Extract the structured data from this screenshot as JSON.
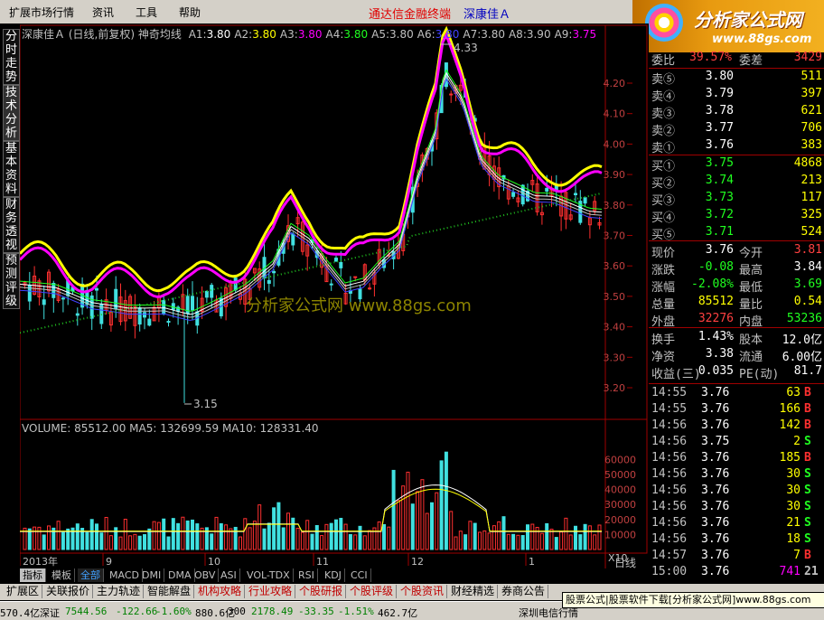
{
  "menu": {
    "items": [
      "扩展市场行情",
      "资讯",
      "工具",
      "帮助"
    ],
    "brand_left": "通达信金融终端",
    "brand_right": "深康佳Ａ"
  },
  "logo": {
    "title": "分析家公式网",
    "url": "www.88gs.com"
  },
  "sidetabs": [
    "分时走势",
    "技术分析",
    "基本资料",
    "财务透视",
    "预测评级"
  ],
  "chart_header": {
    "stock": "深康佳Ａ",
    "mode": "(日线,前复权)",
    "indicator": "神奇均线",
    "params": [
      {
        "label": "A1:",
        "value": "3.80",
        "color": "#ffffff"
      },
      {
        "label": "A2:",
        "value": "3.80",
        "color": "#ffff00"
      },
      {
        "label": "A3:",
        "value": "3.80",
        "color": "#ff00ff"
      },
      {
        "label": "A4:",
        "value": "3.80",
        "color": "#20ff20"
      },
      {
        "label": "A5:",
        "value": "3.80",
        "color": "#c0c0c0"
      },
      {
        "label": "A6:",
        "value": "3.80",
        "color": "#4040ff"
      },
      {
        "label": "A7:",
        "value": "3.80",
        "color": "#c0c0c0"
      },
      {
        "label": "A8:",
        "value": "3.90",
        "color": "#c0c0c0"
      },
      {
        "label": "A9:",
        "value": "3.75",
        "color": "#ff00ff"
      }
    ]
  },
  "price_axis": [
    "4.20",
    "4.10",
    "4.00",
    "3.90",
    "3.80",
    "3.70",
    "3.60",
    "3.50",
    "3.40",
    "3.30",
    "3.20"
  ],
  "annotations": {
    "high": "4.33",
    "low": "3.15"
  },
  "watermark": "分析家公式网 www.88gs.com",
  "volume_header": "VOLUME: 85512.00  MA5: 132699.59  MA10: 128331.40",
  "volume_axis": [
    "60000",
    "50000",
    "40000",
    "30000",
    "20000",
    "10000"
  ],
  "volume_unit": "X10",
  "date_axis": [
    {
      "label": "2013年"
    },
    {
      "label": "9"
    },
    {
      "label": "10"
    },
    {
      "label": "11"
    },
    {
      "label": "12"
    },
    {
      "label": "1"
    }
  ],
  "period": "日线",
  "quote": {
    "ratio_label": "委比",
    "ratio": "39.57%",
    "diff_label": "委差",
    "diff": "3429",
    "asks": [
      {
        "label": "卖⑤",
        "price": "3.80",
        "vol": "511"
      },
      {
        "label": "卖④",
        "price": "3.79",
        "vol": "397"
      },
      {
        "label": "卖③",
        "price": "3.78",
        "vol": "621"
      },
      {
        "label": "卖②",
        "price": "3.77",
        "vol": "706"
      },
      {
        "label": "卖①",
        "price": "3.76",
        "vol": "383"
      }
    ],
    "bids": [
      {
        "label": "买①",
        "price": "3.75",
        "vol": "4868"
      },
      {
        "label": "买②",
        "price": "3.74",
        "vol": "213"
      },
      {
        "label": "买③",
        "price": "3.73",
        "vol": "117"
      },
      {
        "label": "买④",
        "price": "3.72",
        "vol": "325"
      },
      {
        "label": "买⑤",
        "price": "3.71",
        "vol": "524"
      }
    ],
    "stats": [
      {
        "l1": "现价",
        "v1": "3.76",
        "c1": "#ffffff",
        "l2": "今开",
        "v2": "3.81",
        "c2": "#ff4040"
      },
      {
        "l1": "涨跌",
        "v1": "-0.08",
        "c1": "#20ff20",
        "l2": "最高",
        "v2": "3.84",
        "c2": "#ffffff"
      },
      {
        "l1": "涨幅",
        "v1": "-2.08%",
        "c1": "#20ff20",
        "l2": "最低",
        "v2": "3.69",
        "c2": "#20ff20"
      },
      {
        "l1": "总量",
        "v1": "85512",
        "c1": "#ffff00",
        "l2": "量比",
        "v2": "0.54",
        "c2": "#ffff00"
      },
      {
        "l1": "外盘",
        "v1": "32276",
        "c1": "#ff4040",
        "l2": "内盘",
        "v2": "53236",
        "c2": "#20ff20"
      }
    ],
    "stats2": [
      {
        "l1": "换手",
        "v1": "1.43%",
        "l2": "股本",
        "v2": "12.0亿"
      },
      {
        "l1": "净资",
        "v1": "3.38",
        "l2": "流通",
        "v2": "6.00亿"
      },
      {
        "l1": "收益(三)",
        "v1": "0.035",
        "l2": "PE(动)",
        "v2": "81.7"
      }
    ]
  },
  "ticks": [
    {
      "time": "14:55",
      "price": "3.76",
      "vol": "63",
      "bs": "B"
    },
    {
      "time": "14:55",
      "price": "3.76",
      "vol": "166",
      "bs": "B"
    },
    {
      "time": "14:56",
      "price": "3.76",
      "vol": "142",
      "bs": "B"
    },
    {
      "time": "14:56",
      "price": "3.75",
      "vol": "2",
      "bs": "S"
    },
    {
      "time": "14:56",
      "price": "3.76",
      "vol": "185",
      "bs": "B"
    },
    {
      "time": "14:56",
      "price": "3.76",
      "vol": "30",
      "bs": "S"
    },
    {
      "time": "14:56",
      "price": "3.76",
      "vol": "30",
      "bs": "S"
    },
    {
      "time": "14:56",
      "price": "3.76",
      "vol": "30",
      "bs": "S"
    },
    {
      "time": "14:56",
      "price": "3.76",
      "vol": "21",
      "bs": "S"
    },
    {
      "time": "14:56",
      "price": "3.76",
      "vol": "18",
      "bs": "S"
    },
    {
      "time": "14:57",
      "price": "3.76",
      "vol": "7",
      "bs": "B"
    },
    {
      "time": "15:00",
      "price": "3.76",
      "vol": "741",
      "bs": "21"
    }
  ],
  "indicator_tabs": [
    "指标",
    "模板",
    "全部",
    "MACD",
    "DMI",
    "DMA",
    "OBV",
    "ASI",
    "VOL-TDX",
    "RSI",
    "KDJ",
    "CCI"
  ],
  "bottom_toolbar": [
    "扩展区",
    "关联报价",
    "主力轨迹",
    "智能解盘",
    "机构攻略",
    "行业攻略",
    "个股研报",
    "个股评级",
    "个股资讯",
    "财经精选",
    "券商公告"
  ],
  "popup_text": "股票公式|股票软件下载[分析家公式网]www.88gs.com",
  "status": {
    "s1": "570.4亿",
    "label2": "深证",
    "v2": "7544.56",
    "c2": "-122.66",
    "p2": "-1.60%",
    "a2": "880.6亿",
    "label3": "300",
    "v3": "2178.49",
    "c3": "-33.35",
    "p3": "-1.51%",
    "a3": "462.7亿",
    "stock": "深圳电信行情"
  }
}
